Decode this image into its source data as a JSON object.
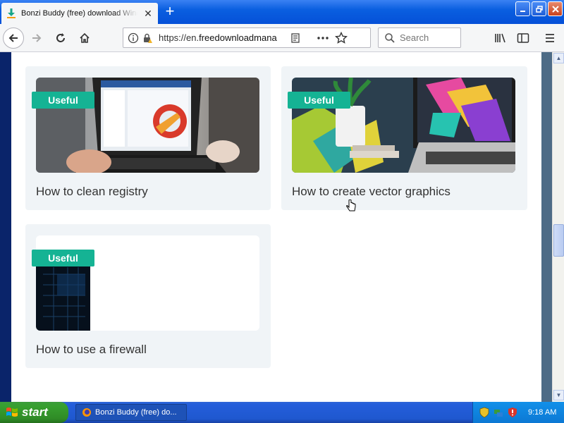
{
  "browser": {
    "tab_title": "Bonzi Buddy (free) download Windows",
    "new_tab_symbol": "+",
    "url_prefix": "https://en.",
    "url_host": "freedownloadmana",
    "search_placeholder": "Search"
  },
  "cards": [
    {
      "badge": "Useful",
      "title": "How to clean registry"
    },
    {
      "badge": "Useful",
      "title": "How to create vector graphics"
    },
    {
      "badge": "Useful",
      "title": "How to use a firewall"
    }
  ],
  "taskbar": {
    "start_label": "start",
    "task_label": "Bonzi Buddy (free) do...",
    "clock": "9:18 AM"
  },
  "colors": {
    "badge": "#15b394",
    "card_bg": "#f0f4f7",
    "title_text": "#333333"
  }
}
